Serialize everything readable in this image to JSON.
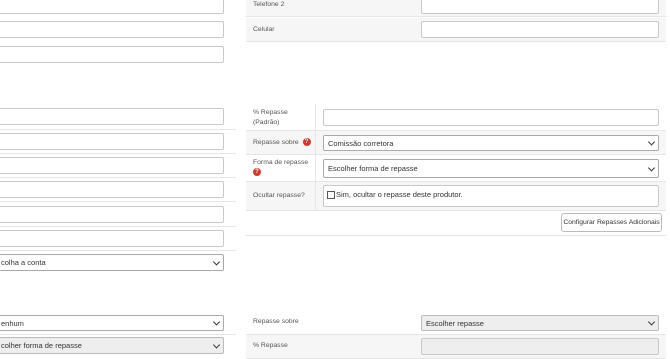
{
  "right_top": {
    "telefone2_label": "Telefone 2",
    "celular_label": "Celular"
  },
  "repasse": {
    "percent_label_line1": "% Repasse",
    "percent_label_line2": "(Padrão)",
    "sobre_label": "Repasse sobre",
    "sobre_value": "Comissão corretora",
    "forma_label": "Forma de repasse",
    "forma_value": "Escolher forma de repasse",
    "ocultar_label": "Ocultar repasse?",
    "ocultar_text": "Sim, ocultar o repasse deste produtor.",
    "config_button": "Configurar Repasses Adicionais"
  },
  "left": {
    "conta_select": "colha a conta",
    "nenhum_select": "enhum",
    "forma_select": "colher forma de repasse"
  },
  "bottom_right": {
    "sobre_label": "Repasse sobre",
    "sobre_value": "Escolher repasse",
    "percent_label": "% Repasse"
  }
}
